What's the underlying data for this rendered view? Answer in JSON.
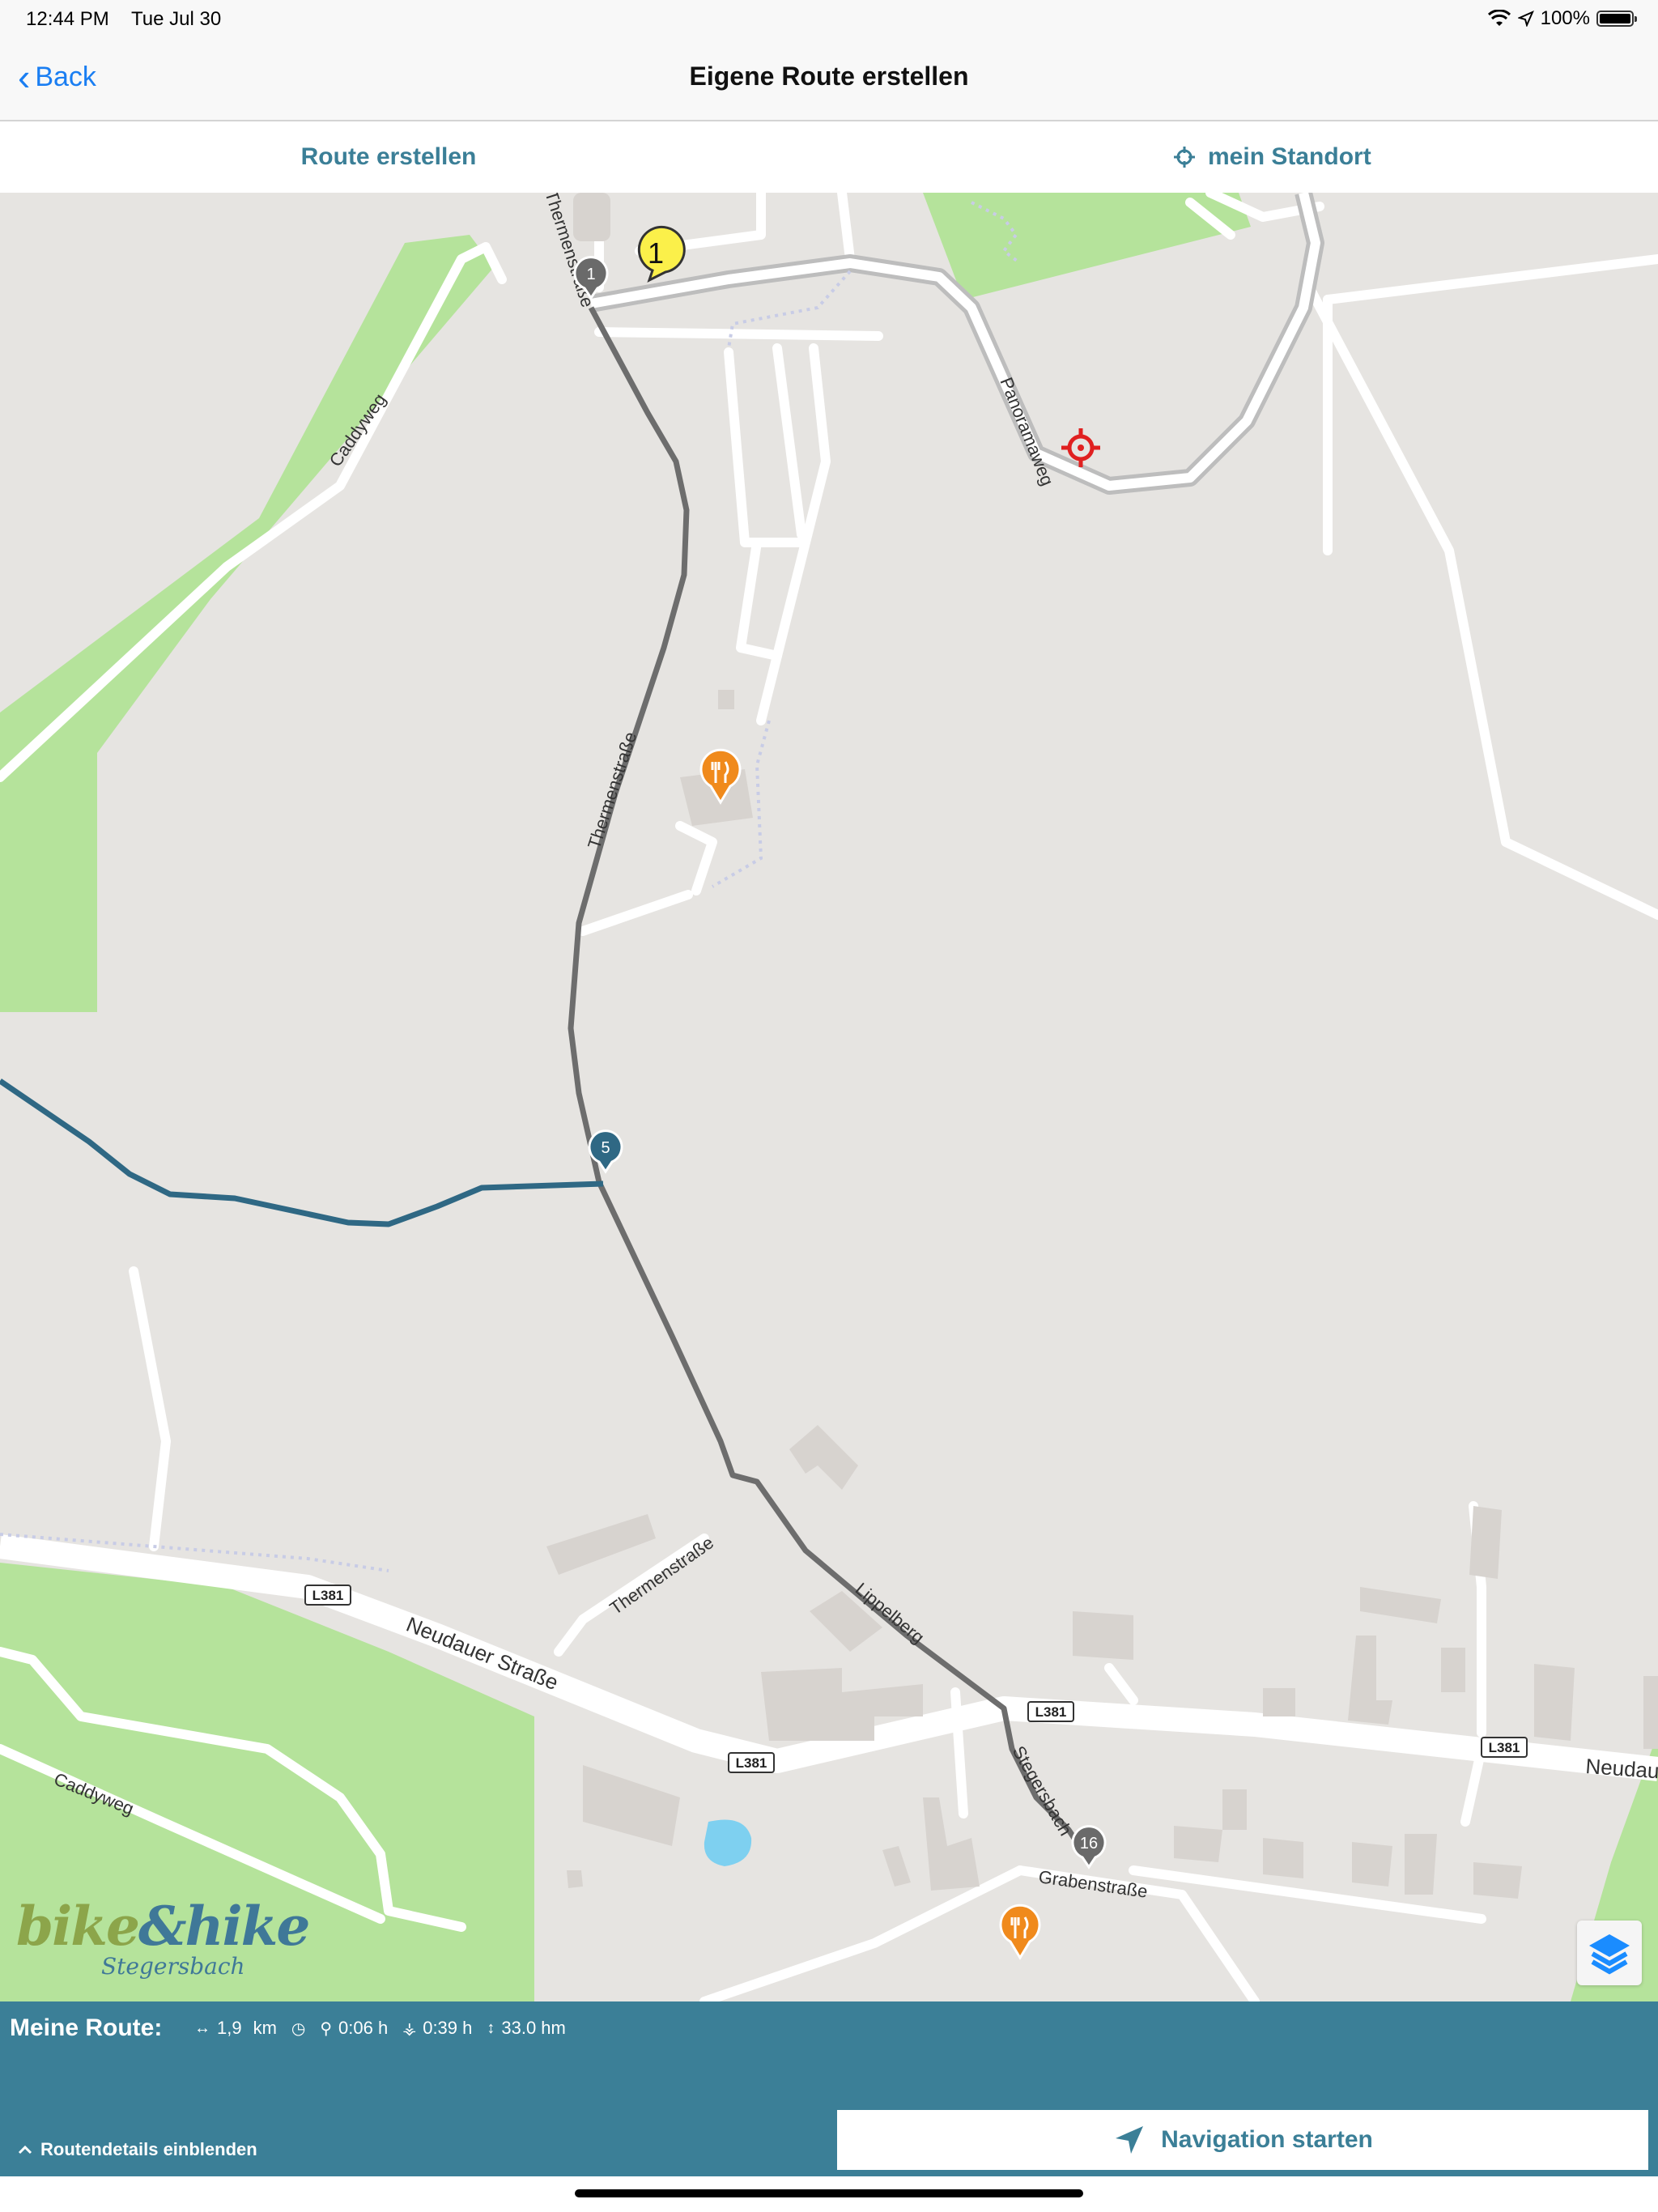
{
  "status_bar": {
    "time": "12:44 PM",
    "date": "Tue Jul 30",
    "battery": "100%"
  },
  "nav": {
    "back_label": "Back",
    "title": "Eigene Route erstellen"
  },
  "toolbar": {
    "create_route": "Route erstellen",
    "my_location": "mein Standort"
  },
  "map": {
    "street_labels": {
      "caddyweg_north": "Caddyweg",
      "thermenstrasse_north": "Thermenstraße",
      "thermenstrasse_mid": "Thermenstraße",
      "thermenstrasse_south": "Thermenstraße",
      "panoramaweg": "Panoramaweg",
      "neudauer_strasse": "Neudauer Straße",
      "neudauer_east": "Neudau",
      "lippelberg": "Lippelberg",
      "stegersbach": "Stegersbach",
      "grabenstrasse": "Grabenstraße",
      "caddyweg_south": "Caddyweg"
    },
    "road_shields": {
      "s1": "L381",
      "s2": "L381",
      "s3": "L381",
      "s4": "L381"
    },
    "markers": {
      "start": "1",
      "waypoint_1": "1",
      "waypoint_5": "5",
      "waypoint_16": "16"
    }
  },
  "logo": {
    "line1_a": "bike",
    "line1_amp": "&",
    "line1_b": "hike",
    "line2": "Stegersbach"
  },
  "route": {
    "label": "Meine Route:",
    "distance": "1,9",
    "distance_unit": "km",
    "bike_time": "0:06 h",
    "walk_time": "0:39 h",
    "elevation": "33.0 hm"
  },
  "details_label": "Routendetails einblenden",
  "navigation_label": "Navigation starten",
  "colors": {
    "accent": "#3b7f97",
    "link": "#1a7ef2",
    "green": "#b5e39b",
    "route_grey": "#7a7a7a",
    "route_blue": "#2f6884"
  }
}
